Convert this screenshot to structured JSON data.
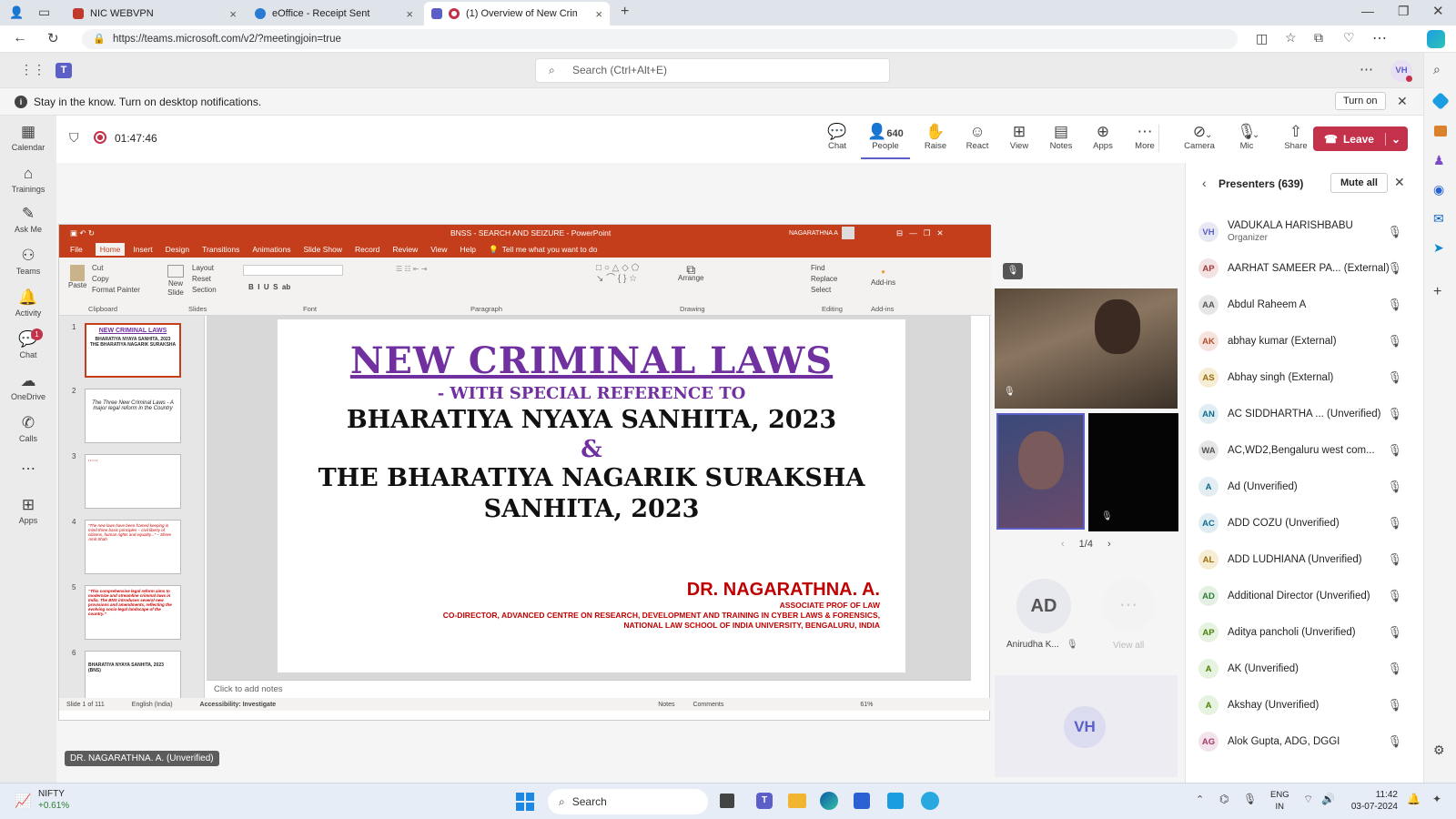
{
  "browser": {
    "tabs": [
      {
        "label": "NIC WEBVPN",
        "color": "#c0392b"
      },
      {
        "label": "eOffice - Receipt Sent",
        "color": "#2a7bd4"
      },
      {
        "label": "(1) Overview of New Crimin",
        "color": "#5b5fc7"
      }
    ],
    "url": "https://teams.microsoft.com/v2/?meetingjoin=true"
  },
  "teams": {
    "search_placeholder": "Search (Ctrl+Alt+E)",
    "user_initials": "VH",
    "notification_text": "Stay in the know. Turn on desktop notifications.",
    "turn_on_label": "Turn on"
  },
  "rail": [
    "Calendar",
    "Trainings",
    "Ask Me",
    "Teams",
    "Activity",
    "Chat",
    "OneDrive",
    "Calls",
    "",
    "Apps"
  ],
  "rail_chat_badge": "1",
  "meeting": {
    "timer": "01:47:46",
    "people_count": "640",
    "tools": [
      "Chat",
      "People",
      "Raise",
      "React",
      "View",
      "Notes",
      "Apps",
      "More",
      "Camera",
      "Mic",
      "Share"
    ],
    "leave_label": "Leave",
    "presenter_tag": "DR. NAGARATHNA. A. (Unverified)",
    "video_pager": "1/4",
    "tile_initials": "AD",
    "tile_name": "Anirudha K...",
    "view_all": "View all",
    "bottom_tile_initials": "VH"
  },
  "ppt": {
    "title": "BNSS - SEARCH AND SEIZURE - PowerPoint",
    "user": "NAGARATHNA A",
    "menu": [
      "File",
      "Home",
      "Insert",
      "Design",
      "Transitions",
      "Animations",
      "Slide Show",
      "Record",
      "Review",
      "View",
      "Help"
    ],
    "tell_me": "Tell me what you want to do",
    "ribbon_groups": [
      "Clipboard",
      "Slides",
      "Font",
      "Paragraph",
      "Drawing",
      "Editing",
      "Add-ins"
    ],
    "ribbon_items": {
      "paste": "Paste",
      "cut": "Cut",
      "copy": "Copy",
      "format_painter": "Format Painter",
      "new_slide": "New Slide",
      "layout": "Layout",
      "reset": "Reset",
      "section": "Section",
      "find": "Find",
      "replace": "Replace",
      "select": "Select",
      "arrange": "Arrange",
      "addins": "Add-ins"
    },
    "thumb_numbers": [
      "1",
      "2",
      "3",
      "4",
      "5",
      "6"
    ],
    "thumb2_text": "The Three New Criminal Laws - A major legal reform in the Country",
    "thumb4_text": "“The new laws have been framed keeping in mind three basic principles – civil liberty of citizens, human rights and equality...” – Shree Amit Shah",
    "thumb5_text": "“This comprehensive legal reform aims to modernize and streamline criminal laws in India. The BNS introduces several new provisions and amendments, reflecting the evolving socio-legal landscape of the country.”",
    "thumb6_text": "BHARATIYA NYAYA SANHITA, 2023 (BNS)",
    "notes_placeholder": "Click to add notes",
    "status_slide": "Slide 1 of 111",
    "status_lang": "English (India)",
    "status_access": "Accessibility: Investigate",
    "status_notes": "Notes",
    "status_comments": "Comments",
    "zoom": "61%"
  },
  "slide": {
    "title": "NEW CRIMINAL LAWS",
    "subtitle": "- WITH SPECIAL REFERENCE TO",
    "line1": "BHARATIYA NYAYA SANHITA, 2023",
    "amp": "&",
    "line2": "THE BHARATIYA NAGARIK SURAKSHA",
    "line3": "SANHITA, 2023",
    "author": "DR. NAGARATHNA. A.",
    "author_role": "ASSOCIATE PROF OF LAW",
    "author_line2": "CO-DIRECTOR, ADVANCED CENTRE ON RESEARCH, DEVELOPMENT AND TRAINING IN CYBER LAWS & FORENSICS,",
    "author_line3": "NATIONAL LAW SCHOOL OF INDIA UNIVERSITY, BENGALURU, INDIA"
  },
  "panel": {
    "title": "Presenters (639)",
    "mute_all": "Mute all",
    "people": [
      {
        "initials": "VH",
        "name": "VADUKALA HARISHBABU",
        "sub": "Organizer",
        "color": "#e8e8f4",
        "fg": "#5b5fc7"
      },
      {
        "initials": "AP",
        "name": "AARHAT SAMEER PA... (External)",
        "sub": "",
        "color": "#f3e3e3",
        "fg": "#a4373a"
      },
      {
        "initials": "AA",
        "name": "Abdul Raheem A",
        "sub": "",
        "color": "#e6e6e6",
        "fg": "#555"
      },
      {
        "initials": "AK",
        "name": "abhay kumar (External)",
        "sub": "",
        "color": "#f6e3dd",
        "fg": "#b24d2d"
      },
      {
        "initials": "AS",
        "name": "Abhay singh (External)",
        "sub": "",
        "color": "#f7ecd4",
        "fg": "#9a6d0a"
      },
      {
        "initials": "AN",
        "name": "AC SIDDHARTHA ...  (Unverified)",
        "sub": "",
        "color": "#e0eef4",
        "fg": "#0e6a8c"
      },
      {
        "initials": "WA",
        "name": "AC,WD2,Bengaluru west com...",
        "sub": "",
        "color": "#e6e6e6",
        "fg": "#555"
      },
      {
        "initials": "A",
        "name": "Ad (Unverified)",
        "sub": "",
        "color": "#e2eef4",
        "fg": "#0e6a8c"
      },
      {
        "initials": "AC",
        "name": "ADD COZU (Unverified)",
        "sub": "",
        "color": "#e0eef4",
        "fg": "#0e6a8c"
      },
      {
        "initials": "AL",
        "name": "ADD LUDHIANA (Unverified)",
        "sub": "",
        "color": "#f7ecd4",
        "fg": "#9a6d0a"
      },
      {
        "initials": "AD",
        "name": "Additional Director (Unverified)",
        "sub": "",
        "color": "#e4f0e4",
        "fg": "#2e7d32"
      },
      {
        "initials": "AP",
        "name": "Aditya pancholi (Unverified)",
        "sub": "",
        "color": "#e6f3e0",
        "fg": "#498205"
      },
      {
        "initials": "A",
        "name": "AK (Unverified)",
        "sub": "",
        "color": "#e6f3e0",
        "fg": "#498205"
      },
      {
        "initials": "A",
        "name": "Akshay (Unverified)",
        "sub": "",
        "color": "#e6f3e0",
        "fg": "#498205"
      },
      {
        "initials": "AG",
        "name": "Alok Gupta, ADG, DGGI",
        "sub": "",
        "color": "#f3e3ea",
        "fg": "#a4376b"
      }
    ]
  },
  "taskbar": {
    "stock_name": "NIFTY",
    "stock_change": "+0.61%",
    "search": "Search",
    "lang1": "ENG",
    "lang2": "IN",
    "time": "11:42",
    "date": "03-07-2024"
  }
}
